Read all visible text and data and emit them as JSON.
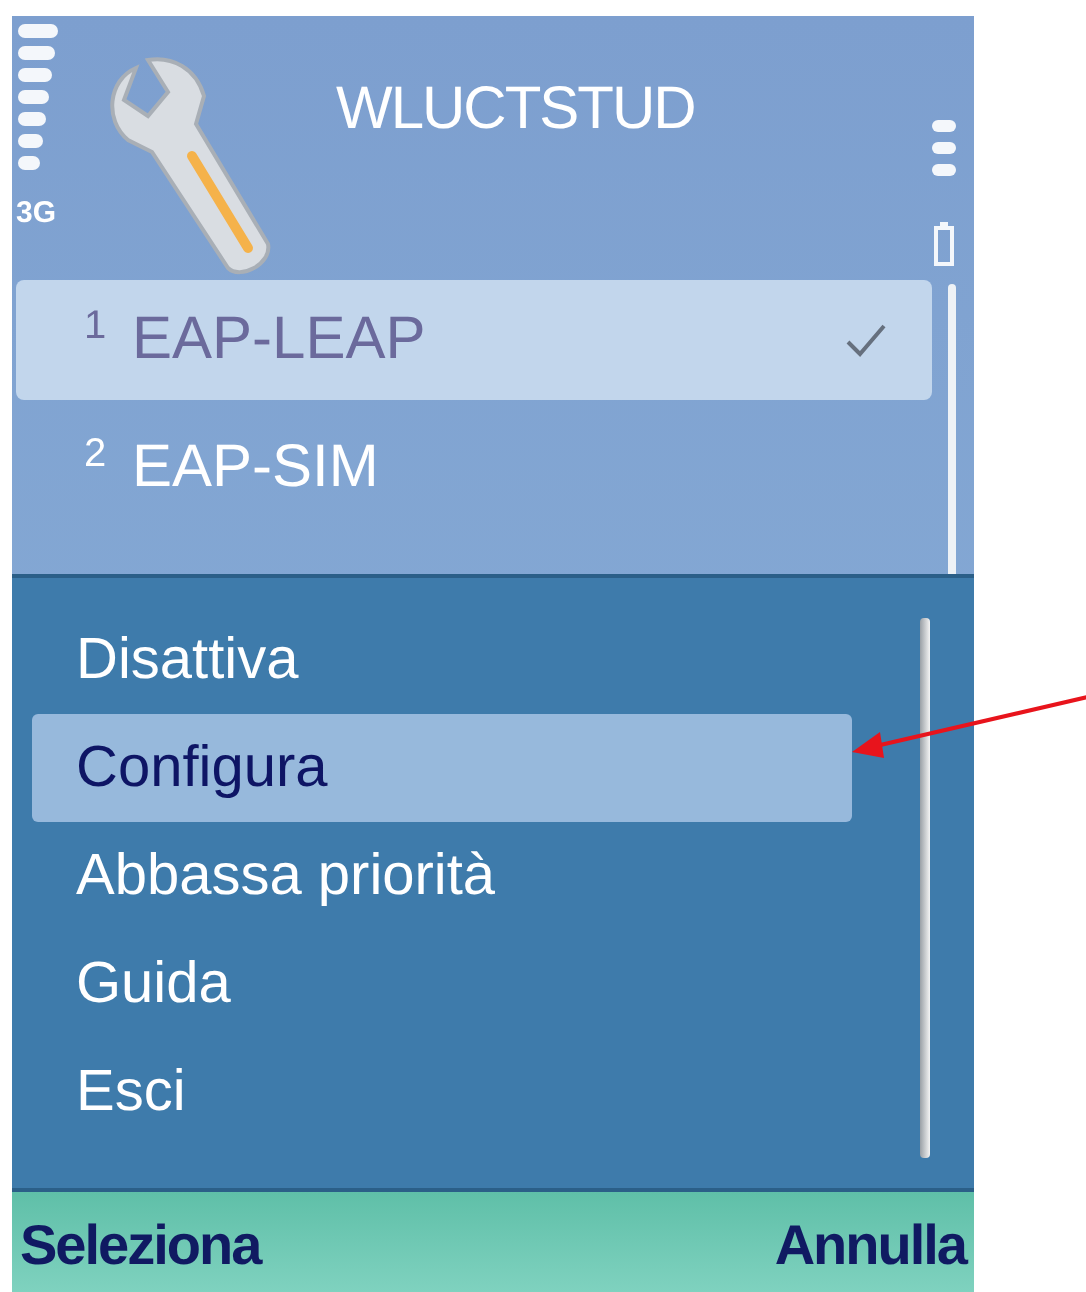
{
  "status": {
    "network": "3G"
  },
  "header": {
    "title": "WLUCTSTUD"
  },
  "list": {
    "items": [
      {
        "number": "1",
        "label": "EAP-LEAP",
        "selected": true,
        "checked": true
      },
      {
        "number": "2",
        "label": "EAP-SIM",
        "selected": false,
        "checked": false
      }
    ]
  },
  "menu": {
    "items": [
      {
        "label": "Disattiva",
        "selected": false
      },
      {
        "label": "Configura",
        "selected": true
      },
      {
        "label": "Abbassa priorità",
        "selected": false
      },
      {
        "label": "Guida",
        "selected": false
      },
      {
        "label": "Esci",
        "selected": false
      }
    ]
  },
  "softkeys": {
    "left": "Seleziona",
    "right": "Annulla"
  }
}
